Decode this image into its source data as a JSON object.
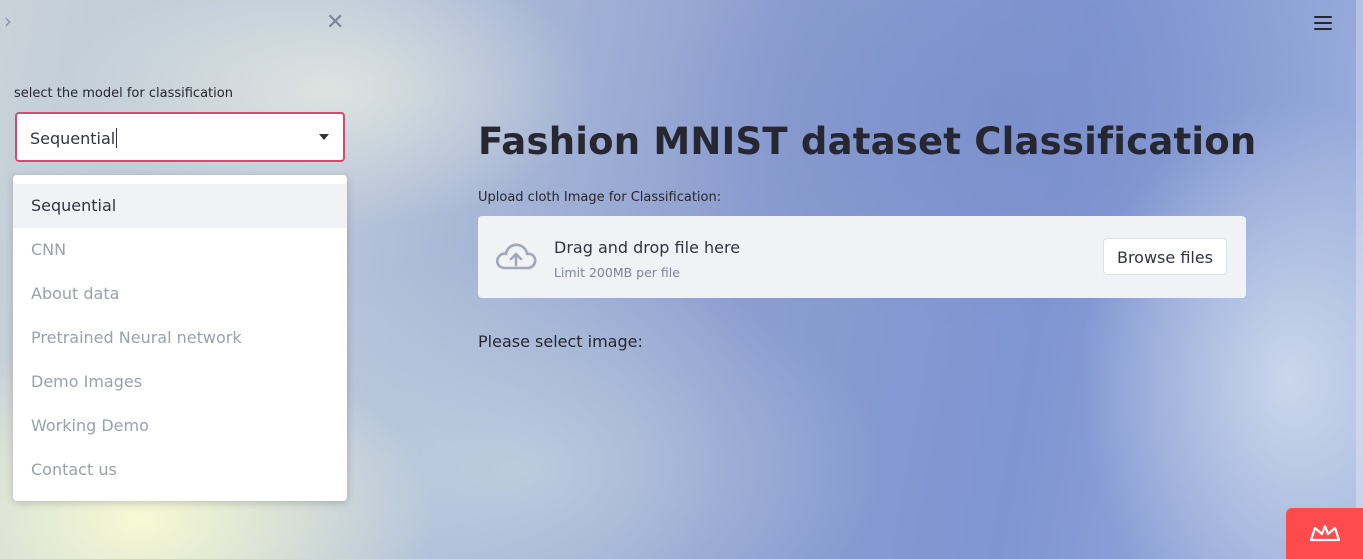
{
  "sidebar": {
    "select_label": "select the model for classification",
    "select_value": "Sequential",
    "options": [
      "Sequential",
      "CNN",
      "About data",
      "Pretrained Neural network",
      "Demo Images",
      "Working Demo",
      "Contact us"
    ],
    "highlighted_option": "Sequential",
    "icons": {
      "expand": "chevron-right-icon",
      "close": "close-icon"
    }
  },
  "header": {
    "menu_icon": "hamburger-menu-icon"
  },
  "main": {
    "title": "Fashion MNIST dataset Classification",
    "uploader": {
      "label": "Upload cloth Image for Classification:",
      "drop_text": "Drag and drop file here",
      "limit_text": "Limit 200MB per file",
      "browse_label": "Browse files",
      "icon": "cloud-upload-icon"
    },
    "status_text": "Please select image:"
  },
  "badge": {
    "icon": "streamlit-crown-icon"
  },
  "colors": {
    "accent_border": "#e1456d",
    "badge": "#ff4b4b",
    "dropzone_bg": "#f0f2f6",
    "text": "#262730"
  }
}
